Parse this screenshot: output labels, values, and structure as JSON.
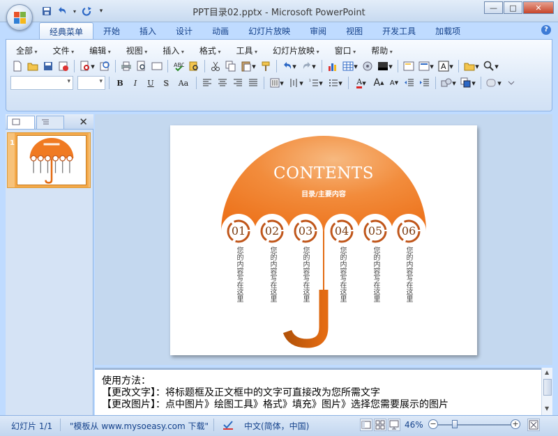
{
  "window": {
    "title": "PPT目录02.pptx - Microsoft PowerPoint",
    "minimize": "—",
    "maximize": "□",
    "close": "✕"
  },
  "ribbon": {
    "tabs": [
      "经典菜单",
      "开始",
      "插入",
      "设计",
      "动画",
      "幻灯片放映",
      "审阅",
      "视图",
      "开发工具",
      "加载项"
    ],
    "active_tab": "经典菜单",
    "help": "?",
    "menus": [
      "全部",
      "文件",
      "编辑",
      "视图",
      "插入",
      "格式",
      "工具",
      "幻灯片放映",
      "窗口",
      "帮助"
    ],
    "format_buttons": {
      "bold": "B",
      "italic": "I",
      "underline": "U",
      "shadow": "S",
      "case": "Aa",
      "grow_font": "A",
      "shrink_font": "A"
    }
  },
  "slide_pane": {
    "slide_number": "1",
    "close": "✕"
  },
  "slide": {
    "title": "CONTENTS",
    "subtitle": "目录/主要内容",
    "items": [
      {
        "number": "01",
        "text": "您的内容写在这里"
      },
      {
        "number": "02",
        "text": "您的内容写在这里"
      },
      {
        "number": "03",
        "text": "您的内容写在这里"
      },
      {
        "number": "04",
        "text": "您的内容写在这里"
      },
      {
        "number": "05",
        "text": "您的内容写在这里"
      },
      {
        "number": "06",
        "text": "您的内容写在这里"
      }
    ],
    "colors": {
      "umbrella": "#f07a22",
      "umbrella_light": "#f4a560",
      "handle": "#e36b12",
      "handle_dark": "#b45309",
      "number_ring": "#c0561a"
    }
  },
  "notes": {
    "lines": [
      "使用方法：",
      "【更改文字】：将标题框及正文框中的文字可直接改为您所需文字",
      "【更改图片】：点中图片》绘图工具》格式》填充》图片》选择您需要展示的图片"
    ]
  },
  "status": {
    "slide_info": "幻灯片 1/1",
    "theme": "\"模板从 www.mysoeasy.com 下载\"",
    "language": "中文(简体，中国)",
    "zoom": "46%",
    "zoom_out": "−",
    "zoom_in": "+"
  }
}
